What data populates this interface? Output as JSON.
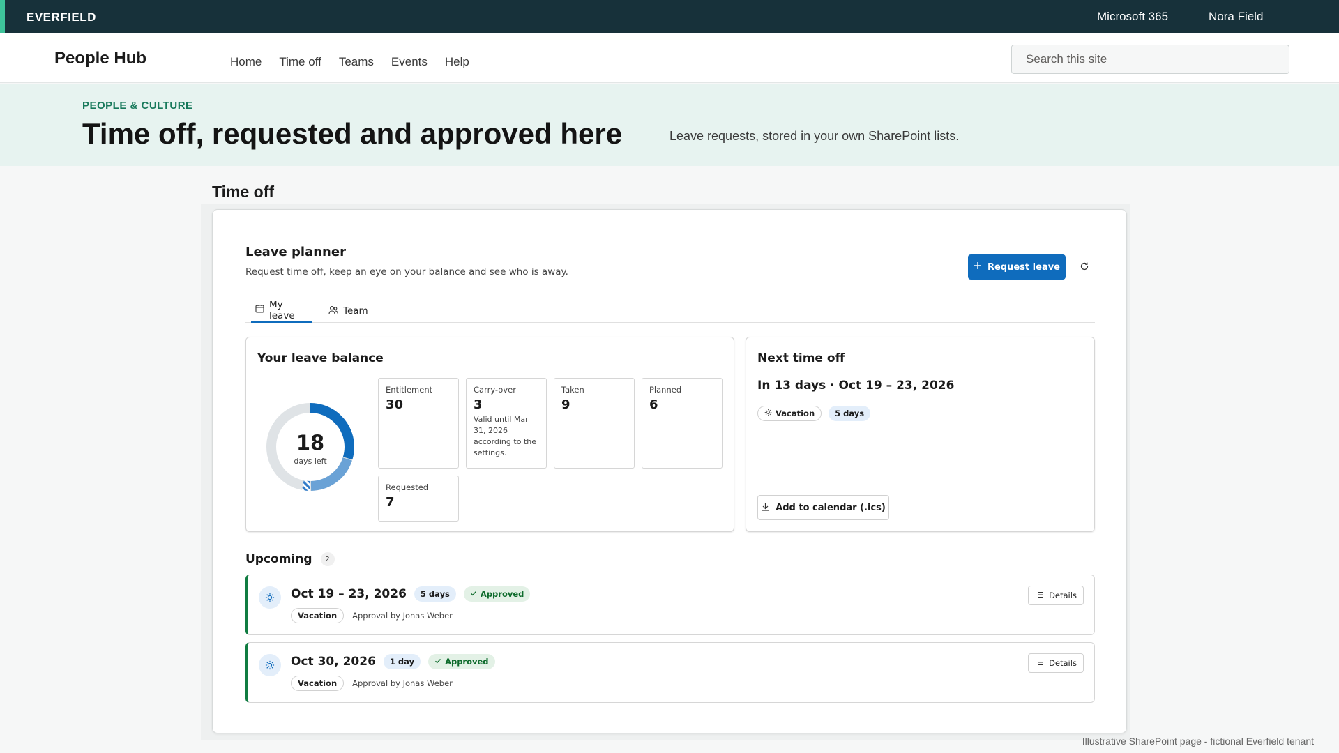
{
  "suitebar": {
    "brand": "EVERFIELD",
    "app_launcher": "Microsoft 365",
    "user": "Nora Field"
  },
  "site": {
    "title": "People Hub",
    "nav": [
      "Home",
      "Time off",
      "Teams",
      "Events",
      "Help"
    ],
    "search_placeholder": "Search this site"
  },
  "hero": {
    "eyebrow": "PEOPLE & CULTURE",
    "headline": "Time off, requested and approved here",
    "tagline": "Leave requests, stored in your own SharePoint lists."
  },
  "section_title": "Time off",
  "planner": {
    "title": "Leave planner",
    "subtitle": "Request time off, keep an eye on your balance and see who is away.",
    "request_button": "Request leave",
    "refresh_icon": "refresh-icon",
    "tabs": [
      {
        "label": "My leave",
        "icon": "calendar-icon",
        "active": true
      },
      {
        "label": "Team",
        "icon": "people-icon",
        "active": false
      }
    ]
  },
  "balance": {
    "title": "Your leave balance",
    "days_left": "18",
    "days_left_label": "days left",
    "entitlement": 30,
    "taken": 9,
    "planned": 6,
    "colors": {
      "taken": "#0f6cbd",
      "planned": "#6aa2d6",
      "requested": "#2f7ac8",
      "remaining": "#dfe3e6"
    },
    "stats": [
      {
        "label": "Entitlement",
        "value": "30",
        "note": ""
      },
      {
        "label": "Carry-over",
        "value": "3",
        "note": "Valid until Mar 31, 2026 according to the settings."
      },
      {
        "label": "Taken",
        "value": "9",
        "note": ""
      },
      {
        "label": "Planned",
        "value": "6",
        "note": ""
      },
      {
        "label": "Requested",
        "value": "7",
        "note": ""
      }
    ]
  },
  "next_time_off": {
    "title": "Next time off",
    "when": "In 13 days · Oct 19 – 23, 2026",
    "type_chip": "Vacation",
    "duration_chip": "5 days",
    "calendar_button": "Add to calendar (.ics)"
  },
  "upcoming": {
    "title": "Upcoming",
    "count": "2",
    "items": [
      {
        "date": "Oct 19 – 23, 2026",
        "duration": "5 days",
        "status": "Approved",
        "type": "Vacation",
        "approver": "Approval by Jonas Weber",
        "details_label": "Details"
      },
      {
        "date": "Oct 30, 2026",
        "duration": "1 day",
        "status": "Approved",
        "type": "Vacation",
        "approver": "Approval by Jonas Weber",
        "details_label": "Details"
      }
    ]
  },
  "footer_note": "Illustrative SharePoint page - fictional Everfield tenant"
}
